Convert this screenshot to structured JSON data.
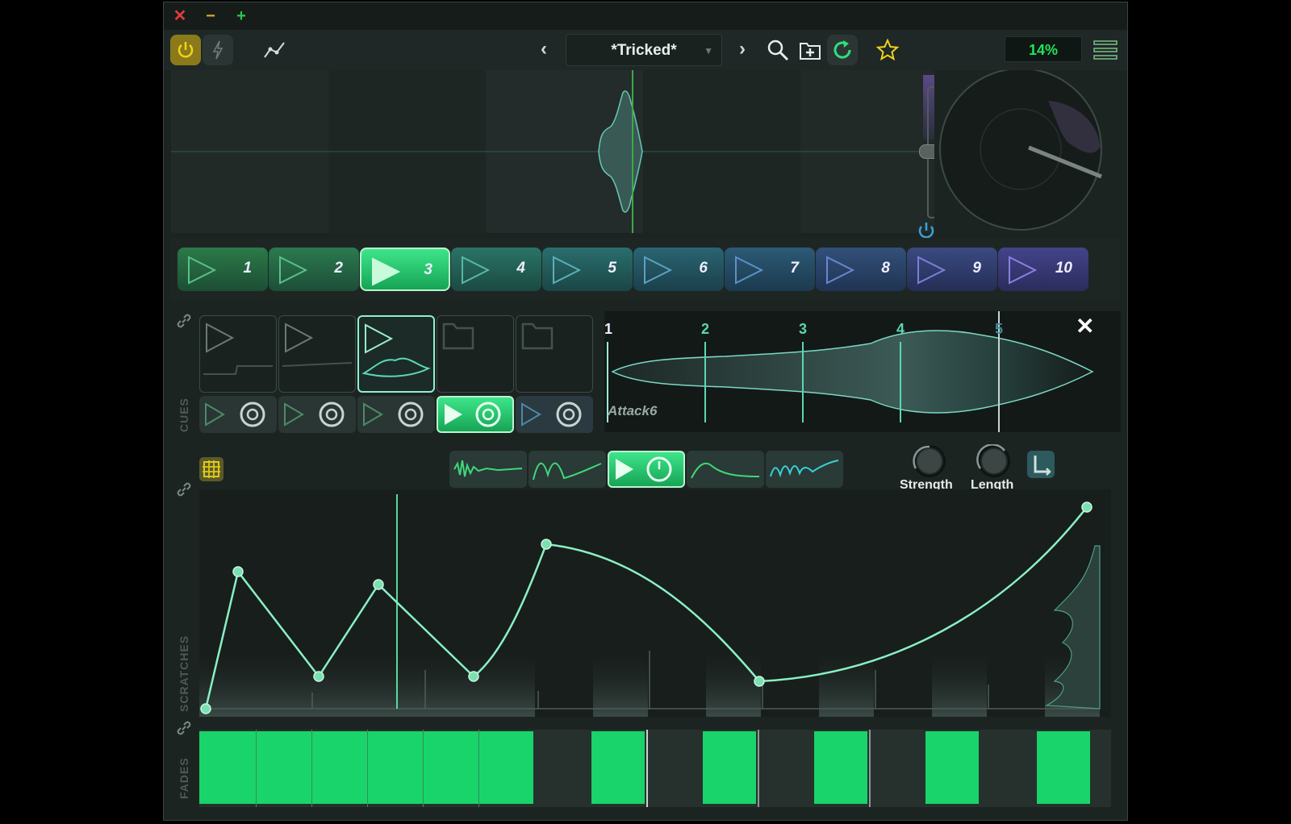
{
  "titlebar": {
    "close": "✕",
    "minimize": "−",
    "maximize": "+"
  },
  "toolbar": {
    "prev": "‹",
    "next": "›",
    "preset_name": "*Tricked*",
    "cpu": "14%"
  },
  "pads": [
    {
      "label": "1",
      "color": "#2b7a49"
    },
    {
      "label": "2",
      "color": "#2b7a4f"
    },
    {
      "label": "3",
      "color": "#2fd070",
      "active": true
    },
    {
      "label": "4",
      "color": "#2a7466"
    },
    {
      "label": "5",
      "color": "#2a6e6e"
    },
    {
      "label": "6",
      "color": "#2a6472"
    },
    {
      "label": "7",
      "color": "#2c5a76"
    },
    {
      "label": "8",
      "color": "#32507a"
    },
    {
      "label": "9",
      "color": "#3a4a80"
    },
    {
      "label": "10",
      "color": "#43448a"
    }
  ],
  "cues": {
    "section_label": "CUES",
    "markers": [
      "1",
      "2",
      "3",
      "4",
      "5"
    ],
    "sample_name": "Attack6",
    "close": "✕"
  },
  "shapes": {
    "strength_label": "Strength",
    "length_label": "Length"
  },
  "scratches": {
    "section_label": "SCRATCHES"
  },
  "fades": {
    "section_label": "FADES",
    "pattern": [
      1,
      1,
      1,
      1,
      1,
      1,
      0,
      1,
      0,
      1,
      0,
      1,
      0,
      1,
      0,
      1
    ]
  },
  "colors": {
    "accent": "#2fe07a",
    "bg": "#1c2421",
    "power": "#e3c21b"
  }
}
